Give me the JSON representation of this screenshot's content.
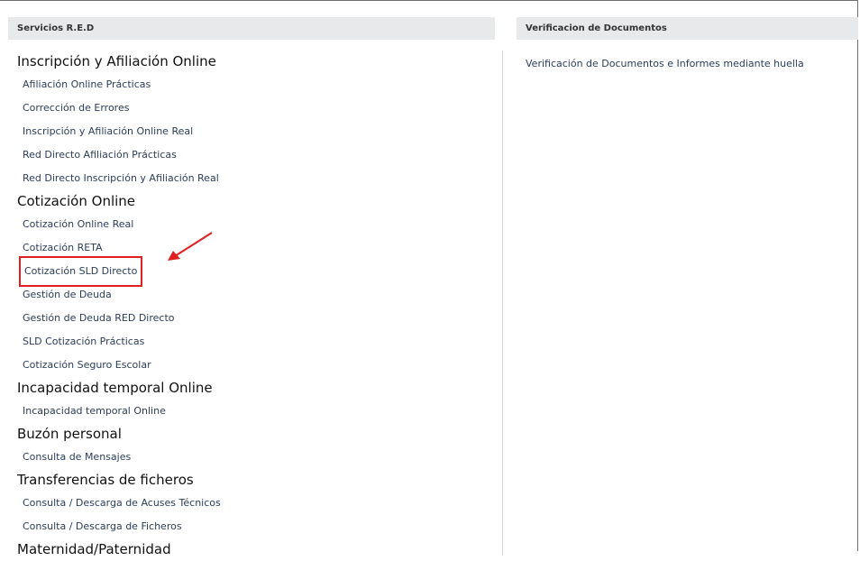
{
  "left_panel": {
    "header": "Servicios R.E.D",
    "sections": [
      {
        "title": "Inscripción y Afiliación Online",
        "links": [
          "Afiliación Online Prácticas",
          "Corrección de Errores",
          "Inscripción y Afiliación Online Real",
          "Red Directo Afiliación Prácticas",
          "Red Directo Inscripción y Afiliación Real"
        ]
      },
      {
        "title": "Cotización Online",
        "links": [
          "Cotización Online Real",
          "Cotización RETA",
          "Cotización SLD Directo",
          "Gestión de Deuda",
          "Gestión de Deuda RED Directo",
          "SLD Cotización Prácticas",
          "Cotización Seguro Escolar"
        ]
      },
      {
        "title": "Incapacidad temporal Online",
        "links": [
          "Incapacidad temporal Online"
        ]
      },
      {
        "title": "Buzón personal",
        "links": [
          "Consulta de Mensajes"
        ]
      },
      {
        "title": "Transferencias de ficheros",
        "links": [
          "Consulta / Descarga de Acuses Técnicos",
          "Consulta / Descarga de Ficheros"
        ]
      },
      {
        "title": "Maternidad/Paternidad",
        "links": []
      }
    ]
  },
  "right_panel": {
    "header": "Verificacion de Documentos",
    "link": "Verificación de Documentos e Informes mediante huella"
  },
  "annotation": {
    "highlighted_link": "Cotización SLD Directo",
    "color": "#e02020"
  }
}
